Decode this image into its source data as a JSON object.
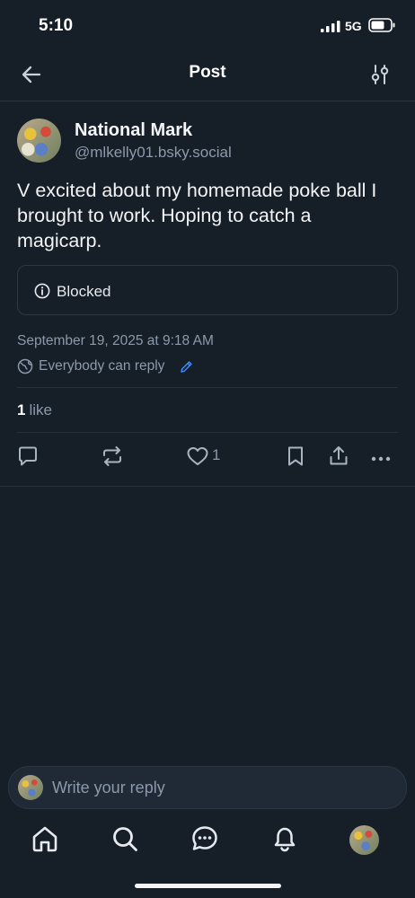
{
  "status_bar": {
    "time": "5:10",
    "network": "5G"
  },
  "header": {
    "title": "Post"
  },
  "post": {
    "author_name": "National Mark",
    "author_handle": "@mlkelly01.bsky.social",
    "text": "V excited about my homemade poke ball I brought to work. Hoping to catch a magicarp.",
    "embed_label": "Blocked",
    "timestamp": "September 19, 2025 at 9:18 AM",
    "reply_setting": "Everybody can reply",
    "like_count": "1",
    "like_word": "like",
    "action_like_count": "1"
  },
  "composer": {
    "placeholder": "Write your reply"
  },
  "colors": {
    "background": "#161e27",
    "accent": "#3a8cff",
    "muted": "#8d9aab"
  },
  "icons": [
    "back-arrow-icon",
    "filter-sliders-icon",
    "info-icon",
    "globe-icon",
    "pencil-icon",
    "reply-icon",
    "repost-icon",
    "heart-icon",
    "bookmark-icon",
    "share-icon",
    "more-icon",
    "home-icon",
    "search-icon",
    "chat-icon",
    "bell-icon"
  ]
}
